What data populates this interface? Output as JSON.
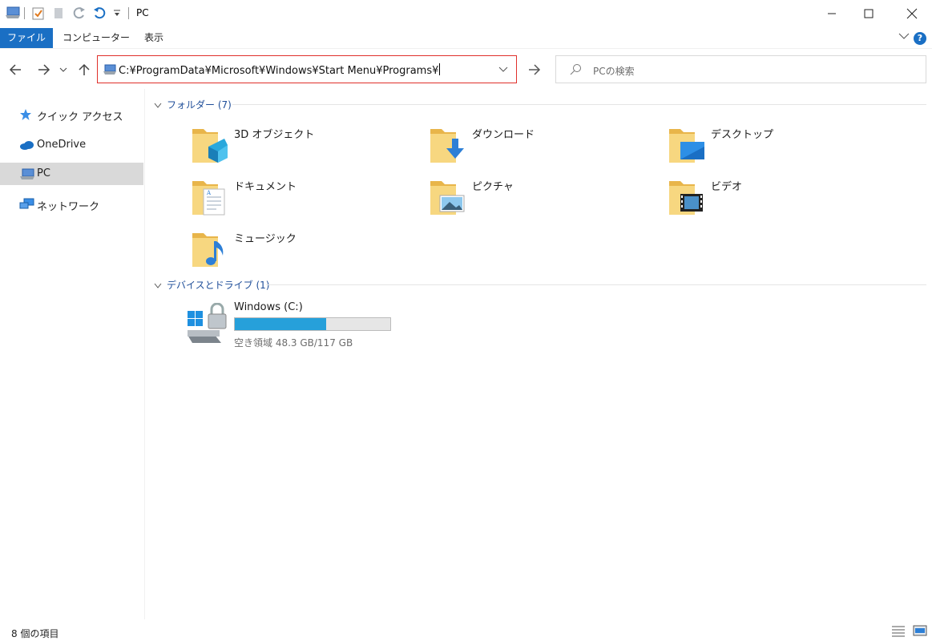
{
  "window": {
    "title": "PC"
  },
  "ribbon": {
    "tabs": [
      {
        "label": "ファイル"
      },
      {
        "label": "コンピューター"
      },
      {
        "label": "表示"
      }
    ],
    "help_label": "?"
  },
  "address_bar": {
    "path": "C:¥ProgramData¥Microsoft¥Windows¥Start Menu¥Programs¥",
    "highlight_color": "#e0302b"
  },
  "search": {
    "placeholder": "PCの検索"
  },
  "sidebar": {
    "items": [
      {
        "label": "クイック アクセス",
        "icon": "star-icon"
      },
      {
        "label": "OneDrive",
        "icon": "cloud-icon"
      },
      {
        "label": "PC",
        "icon": "pc-icon",
        "selected": true
      },
      {
        "label": "ネットワーク",
        "icon": "network-icon"
      }
    ]
  },
  "groups": {
    "folders": {
      "label": "フォルダー (7)"
    },
    "drives": {
      "label": "デバイスとドライブ (1)"
    }
  },
  "folders": [
    {
      "label": "3D オブジェクト",
      "icon": "3d-objects-folder-icon"
    },
    {
      "label": "ダウンロード",
      "icon": "downloads-folder-icon"
    },
    {
      "label": "デスクトップ",
      "icon": "desktop-folder-icon"
    },
    {
      "label": "ドキュメント",
      "icon": "documents-folder-icon"
    },
    {
      "label": "ピクチャ",
      "icon": "pictures-folder-icon"
    },
    {
      "label": "ビデオ",
      "icon": "videos-folder-icon"
    },
    {
      "label": "ミュージック",
      "icon": "music-folder-icon"
    }
  ],
  "drive": {
    "name": "Windows (C:)",
    "free_text": "空き領域 48.3 GB/117 GB",
    "used_fraction": 0.59,
    "bar_color": "#26a0da"
  },
  "status": {
    "item_count": "8 個の項目"
  }
}
